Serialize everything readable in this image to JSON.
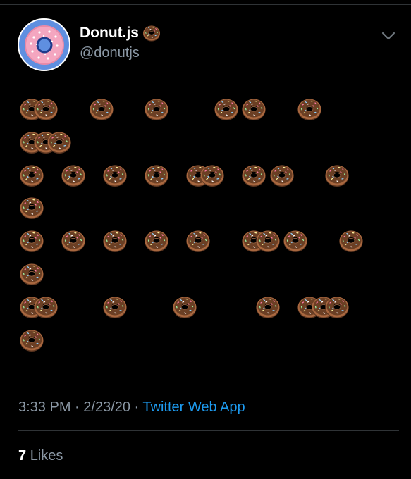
{
  "author": {
    "name": "Donut.js",
    "name_badge_icon": "doughnut-emoji",
    "handle": "@donutjs",
    "avatar_icon": "pink-donut-logo"
  },
  "more_menu_icon": "chevron-down-icon",
  "tweet_body": {
    "glyph": "doughnut-emoji",
    "lines": [
      {
        "pattern": "XX...X...X....X.X...X"
      },
      {
        "pattern": "XXX"
      },
      {
        "pattern": "X..X..X..X..XX..X.X...X"
      },
      {
        "pattern": "X"
      },
      {
        "pattern": "X..X..X..X..X...XX.X...X"
      },
      {
        "pattern": "X"
      },
      {
        "pattern": "XX....X....X.....X..XXX"
      },
      {
        "pattern": "X"
      }
    ]
  },
  "meta": {
    "time": "3:33 PM",
    "sep1": " · ",
    "date": "2/23/20",
    "sep2": " · ",
    "source": "Twitter Web App"
  },
  "likes": {
    "count": "7",
    "label": "Likes"
  },
  "colors": {
    "background": "#000000",
    "text_primary": "#ffffff",
    "text_secondary": "#8b98a5",
    "link": "#1d9bf0",
    "avatar_bg": "#5f8fe0",
    "donut_icing": "#f4a6c0",
    "donut_dough": "#8a5a3b"
  }
}
